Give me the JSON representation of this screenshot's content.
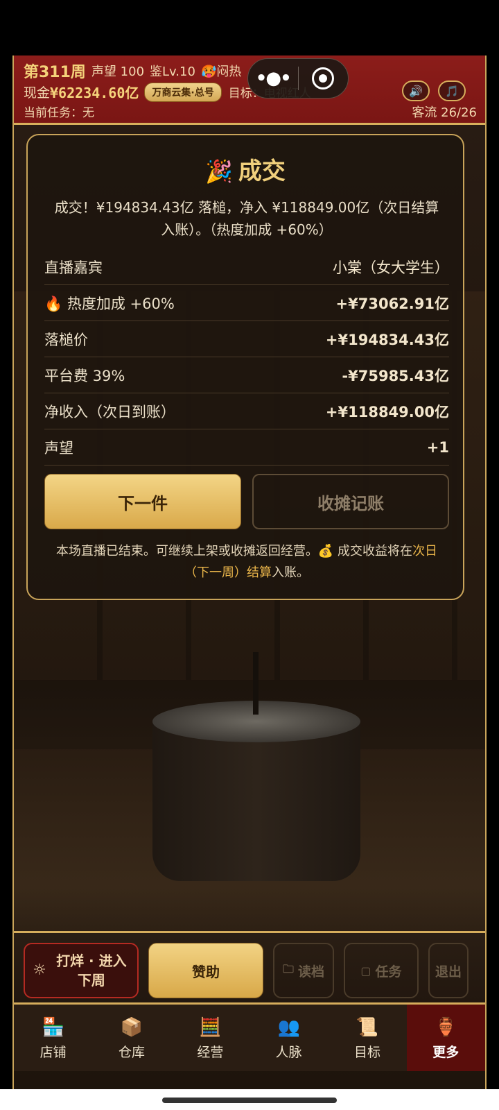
{
  "header": {
    "week": "第311周",
    "reputation": "声望 100",
    "appraise_level": "鉴Lv.10",
    "weather": "🥵闷热",
    "cash_label": "现金",
    "cash_value": "¥62234.60亿",
    "account_badge": "万商云集·总号",
    "goal": "目标：电视红人",
    "current_task": "当前任务：无",
    "customers": "客流 26/26",
    "sound_icon": "🔊",
    "music_icon": "🎵"
  },
  "modal": {
    "title_emoji": "🎉",
    "title": "成交",
    "message": "成交！¥194834.43亿 落槌，净入 ¥118849.00亿（次日结算入账）。（热度加成 +60%）",
    "rows": [
      {
        "key": "直播嘉宾",
        "value": "小棠（女大学生）"
      },
      {
        "key": "🔥 热度加成 +60%",
        "value": "+¥73062.91亿"
      },
      {
        "key": "落槌价",
        "value": "+¥194834.43亿"
      },
      {
        "key": "平台费 39%",
        "value": "-¥75985.43亿"
      },
      {
        "key": "净收入（次日到账）",
        "value": "+¥118849.00亿"
      },
      {
        "key": "声望",
        "value": "+1"
      }
    ],
    "next_button": "下一件",
    "settle_button": "收摊记账",
    "note_prefix": "本场直播已结束。可继续上架或收摊返回经营。💰 成交收益将在",
    "note_highlight": "次日（下一周）结算",
    "note_suffix": "入账。"
  },
  "actions": {
    "close_shop": "打烊 · 进入下周",
    "sponsor": "赞助",
    "load": "读档",
    "task": "任务",
    "exit": "退出"
  },
  "tabs": [
    {
      "icon": "🏪",
      "label": "店铺"
    },
    {
      "icon": "📦",
      "label": "仓库"
    },
    {
      "icon": "🧮",
      "label": "经营"
    },
    {
      "icon": "👥",
      "label": "人脉"
    },
    {
      "icon": "📜",
      "label": "目标"
    },
    {
      "icon": "🏺",
      "label": "更多"
    }
  ]
}
